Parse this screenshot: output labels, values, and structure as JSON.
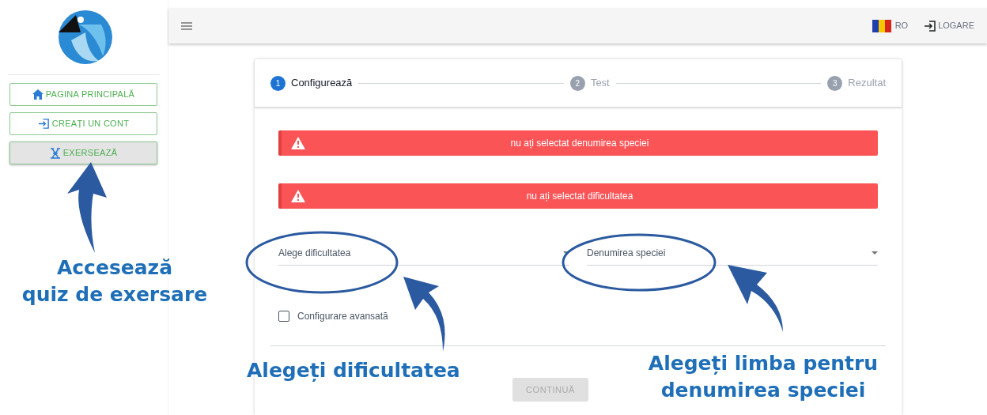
{
  "sidebar": {
    "nav_items": [
      {
        "label": "PAGINA PRINCIPALĂ",
        "selected": false
      },
      {
        "label": "CREAȚI UN CONT",
        "selected": false
      },
      {
        "label": "EXERSEAZĂ",
        "selected": true
      }
    ]
  },
  "topbar": {
    "language": "RO",
    "login": "LOGARE"
  },
  "stepper": {
    "steps": [
      {
        "number": "1",
        "label": "Configurează",
        "selected": true
      },
      {
        "number": "2",
        "label": "Test",
        "selected": false
      },
      {
        "number": "3",
        "label": "Rezultat",
        "selected": false
      }
    ]
  },
  "alerts": [
    "nu ați selectat denumirea speciei",
    "nu ați selectat dificultatea"
  ],
  "form": {
    "difficulty": {
      "placeholder": "Alege dificultatea"
    },
    "species_name": {
      "placeholder": "Denumirea speciei"
    },
    "advanced": {
      "label": "Configurare avansată",
      "checked": false
    }
  },
  "continue_button": {
    "label": "CONTINUĂ",
    "disabled": true
  },
  "annotations": [
    {
      "text": "Accesează\nquiz de exersare"
    },
    {
      "text": "Alegeți dificultatea"
    },
    {
      "text": "Alegeți limba pentru\ndenumirea speciei"
    }
  ]
}
